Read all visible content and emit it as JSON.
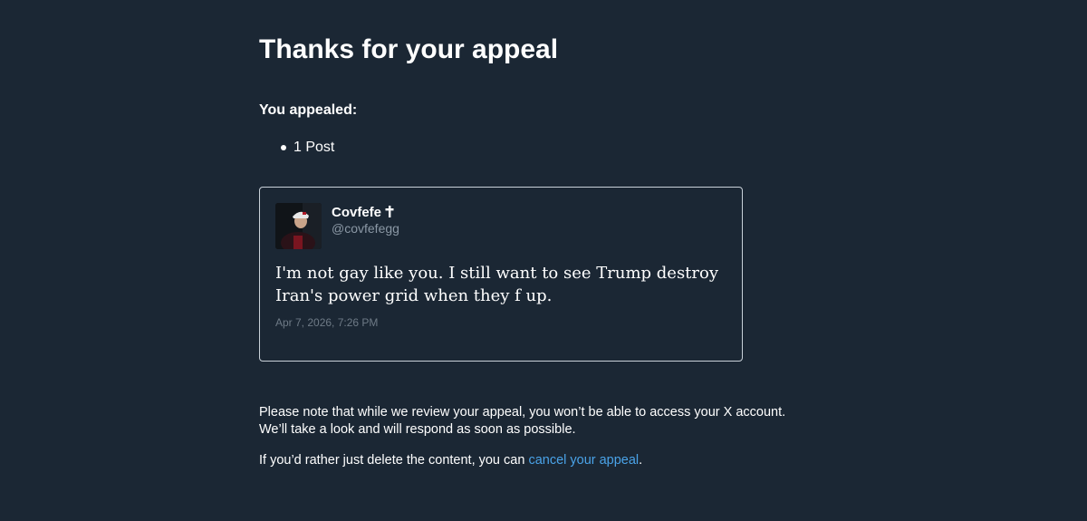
{
  "page": {
    "title": "Thanks for your appeal",
    "appealed_label": "You appealed:",
    "appealed_items": [
      "1 Post"
    ]
  },
  "post": {
    "author_name": "Covfefe",
    "author_badge_icon": "latin-cross-icon",
    "author_handle": "@covfefegg",
    "text": "I'm not gay like you. I still want to see Trump destroy Iran's power grid when they f up.",
    "timestamp": "Apr 7, 2026, 7:26 PM"
  },
  "notice": {
    "line1": "Please note that while we review your appeal, you won’t be able to access your X account.",
    "line2": "We’ll take a look and will respond as soon as possible.",
    "cancel_prefix": "If you’d rather just delete the content, you can ",
    "cancel_link": "cancel your appeal",
    "cancel_suffix": "."
  },
  "colors": {
    "background": "#1b2734",
    "link": "#4aa3e8",
    "muted": "#8b98a5",
    "card_border": "#c9d1d9"
  }
}
